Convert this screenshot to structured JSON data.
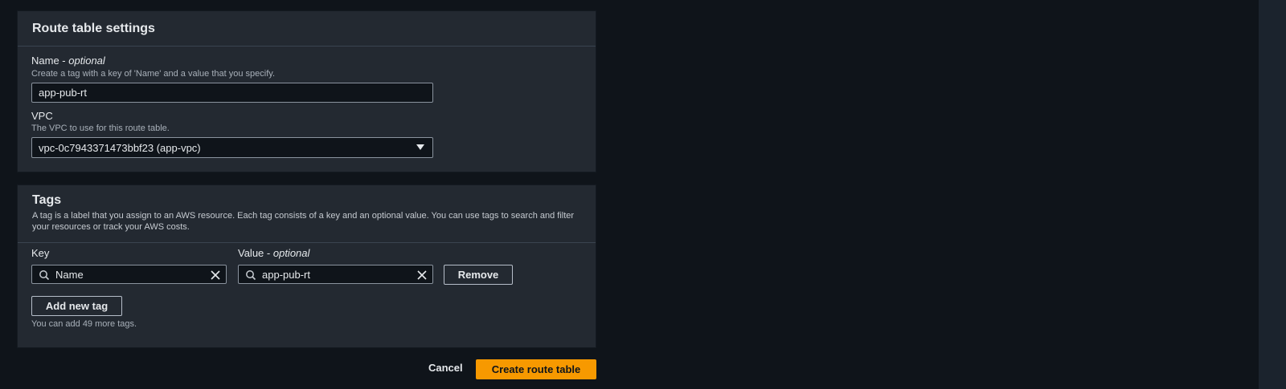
{
  "settings": {
    "title": "Route table settings",
    "name_label": "Name",
    "name_label_optional": "optional",
    "name_desc": "Create a tag with a key of 'Name' and a value that you specify.",
    "name_value": "app-pub-rt",
    "vpc_label": "VPC",
    "vpc_desc": "The VPC to use for this route table.",
    "vpc_value": "vpc-0c7943371473bbf23 (app-vpc)"
  },
  "tags": {
    "title": "Tags",
    "desc": "A tag is a label that you assign to an AWS resource. Each tag consists of a key and an optional value. You can use tags to search and filter your resources or track your AWS costs.",
    "key_label": "Key",
    "value_label": "Value",
    "value_label_optional": "optional",
    "rows": [
      {
        "key": "Name",
        "value": "app-pub-rt"
      }
    ],
    "remove_label": "Remove",
    "add_label": "Add new tag",
    "hint": "You can add 49 more tags."
  },
  "footer": {
    "cancel_label": "Cancel",
    "create_label": "Create route table"
  },
  "icons": {
    "search": "search-icon",
    "clear": "close-icon",
    "caret": "caret-down-icon"
  },
  "colors": {
    "primary": "#f79900",
    "panel": "#232931",
    "background": "#0f141a"
  }
}
